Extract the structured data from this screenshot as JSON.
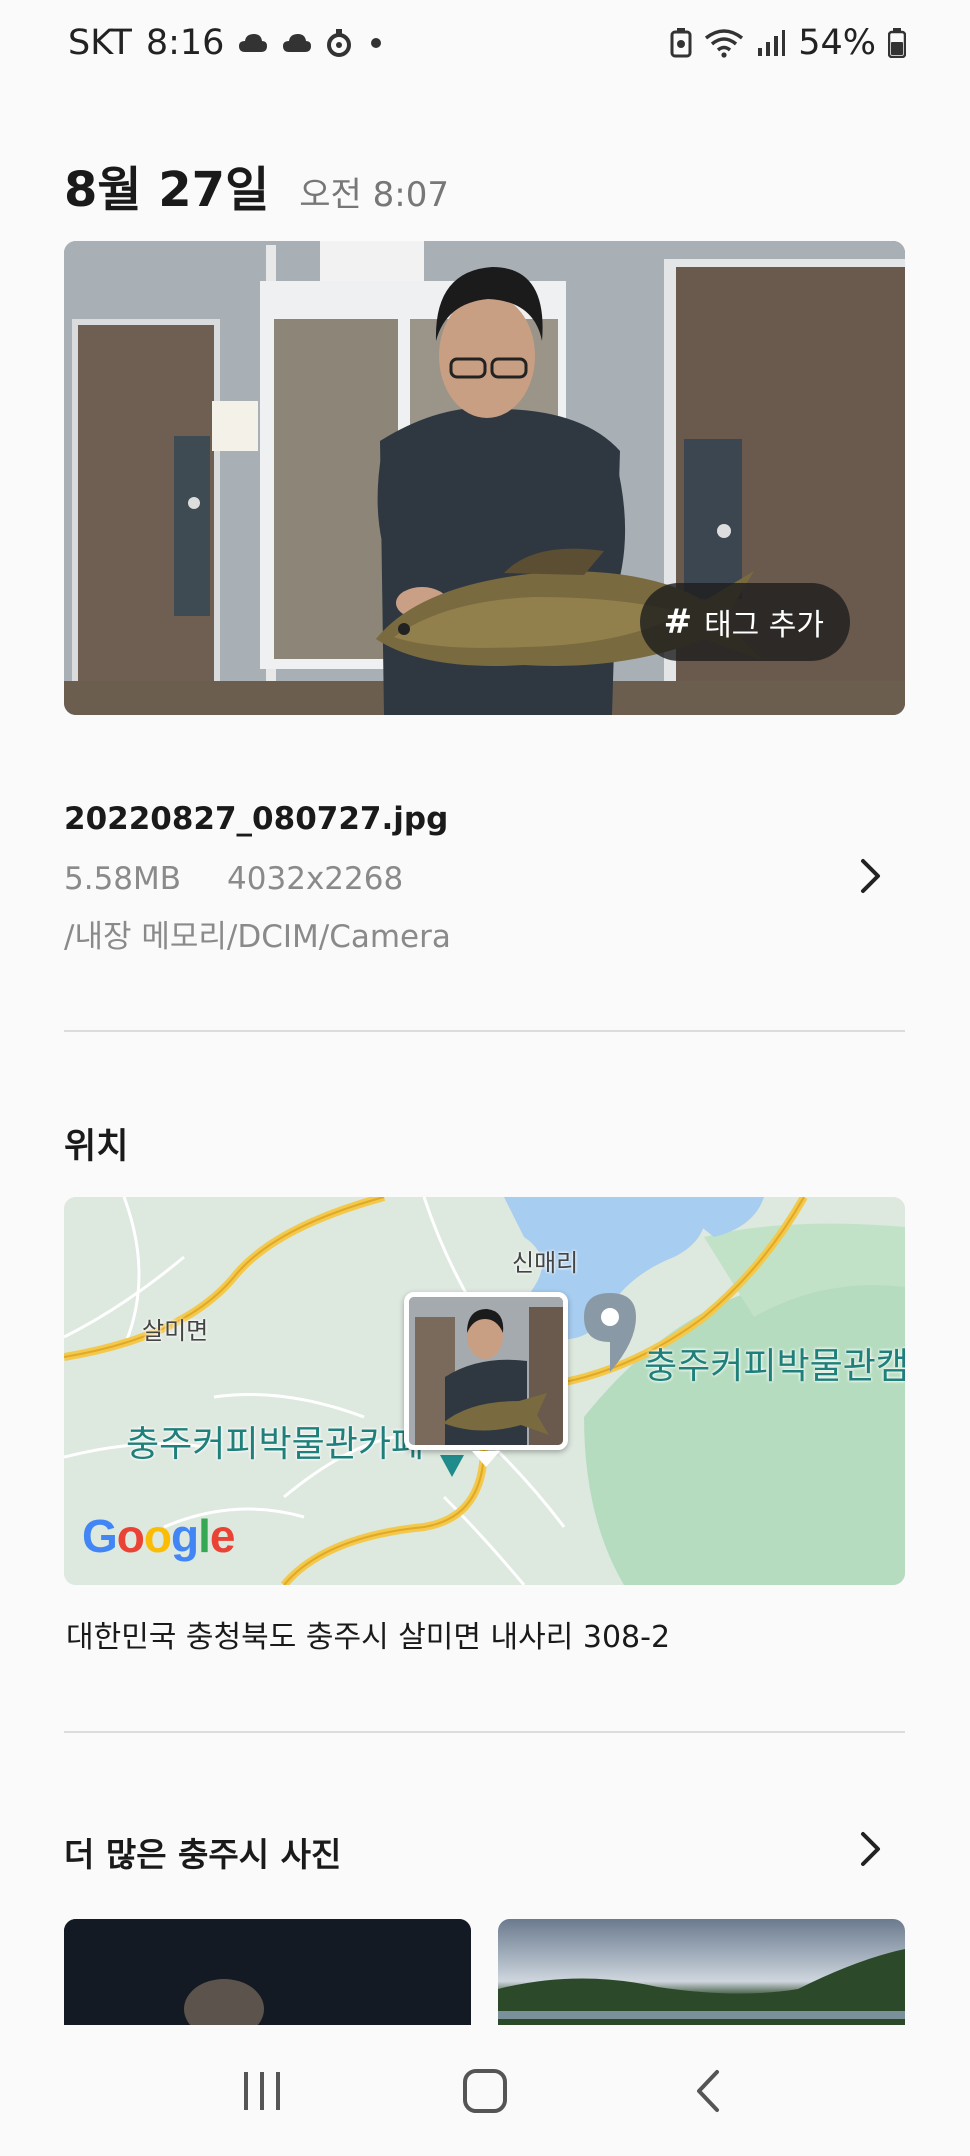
{
  "status_bar": {
    "carrier": "SKT",
    "time": "8:16",
    "battery": "54%"
  },
  "header": {
    "date": "8월 27일",
    "time": "오전 8:07"
  },
  "photo": {
    "tag_button_label": "태그 추가",
    "tag_symbol": "#"
  },
  "file_info": {
    "filename": "20220827_080727.jpg",
    "size": "5.58MB",
    "resolution": "4032x2268",
    "path": "/내장 메모리/DCIM/Camera"
  },
  "location": {
    "title": "위치",
    "map_labels": {
      "village1": "신매리",
      "village2": "살미면",
      "place_right": "충주커피박물관캠",
      "place_left": "충주커피박물관카페"
    },
    "map_brand": "Google",
    "address": "대한민국 충청북도 충주시 살미면 내사리 308-2"
  },
  "more": {
    "title": "더 많은 충주시 사진"
  },
  "nav": {
    "recent": "recent-apps-icon",
    "home": "home-icon",
    "back": "back-icon"
  },
  "colors": {
    "background": "#fafafa",
    "map_teal": "#1f7f7a",
    "divider": "#dcdcdc"
  }
}
